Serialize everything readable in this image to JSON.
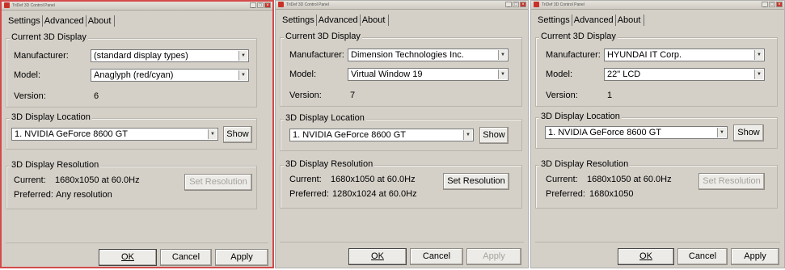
{
  "panels": [
    {
      "title": "TriDef 3D Control Panel",
      "tabs": [
        "Settings",
        "Advanced",
        "About"
      ],
      "display": {
        "group_label": "Current 3D Display",
        "manufacturer_label": "Manufacturer:",
        "manufacturer_value": "(standard display types)",
        "model_label": "Model:",
        "model_value": "Anaglyph (red/cyan)",
        "version_label": "Version:",
        "version_value": "6"
      },
      "location": {
        "group_label": "3D Display Location",
        "selected": "1. NVIDIA GeForce 8600 GT",
        "show_label": "Show"
      },
      "resolution": {
        "group_label": "3D Display Resolution",
        "current_label": "Current:",
        "current_value": "1680x1050 at 60.0Hz",
        "preferred_label": "Preferred:",
        "preferred_value": "Any resolution",
        "set_label": "Set Resolution",
        "set_enabled": false
      },
      "footer": {
        "ok": "OK",
        "cancel": "Cancel",
        "apply": "Apply",
        "apply_enabled": true
      }
    },
    {
      "title": "TriDef 3D Control Panel",
      "tabs": [
        "Settings",
        "Advanced",
        "About"
      ],
      "display": {
        "group_label": "Current 3D Display",
        "manufacturer_label": "Manufacturer:",
        "manufacturer_value": "Dimension Technologies Inc.",
        "model_label": "Model:",
        "model_value": "Virtual Window 19",
        "version_label": "Version:",
        "version_value": "7"
      },
      "location": {
        "group_label": "3D Display Location",
        "selected": "1. NVIDIA GeForce 8600 GT",
        "show_label": "Show"
      },
      "resolution": {
        "group_label": "3D Display Resolution",
        "current_label": "Current:",
        "current_value": "1680x1050 at 60.0Hz",
        "preferred_label": "Preferred:",
        "preferred_value": "1280x1024 at 60.0Hz",
        "set_label": "Set Resolution",
        "set_enabled": true
      },
      "footer": {
        "ok": "OK",
        "cancel": "Cancel",
        "apply": "Apply",
        "apply_enabled": false
      }
    },
    {
      "title": "TriDef 3D Control Panel",
      "tabs": [
        "Settings",
        "Advanced",
        "About"
      ],
      "display": {
        "group_label": "Current 3D Display",
        "manufacturer_label": "Manufacturer:",
        "manufacturer_value": "HYUNDAI IT Corp.",
        "model_label": "Model:",
        "model_value": "22\" LCD",
        "version_label": "Version:",
        "version_value": "1"
      },
      "location": {
        "group_label": "3D Display Location",
        "selected": "1. NVIDIA GeForce 8600 GT",
        "show_label": "Show"
      },
      "resolution": {
        "group_label": "3D Display Resolution",
        "current_label": "Current:",
        "current_value": "1680x1050 at 60.0Hz",
        "preferred_label": "Preferred:",
        "preferred_value": "1680x1050",
        "set_label": "Set Resolution",
        "set_enabled": false
      },
      "footer": {
        "ok": "OK",
        "cancel": "Cancel",
        "apply": "Apply",
        "apply_enabled": true
      }
    }
  ],
  "colors": {
    "window_bg": "#d4d0c8",
    "active_border": "#d44a4a"
  }
}
